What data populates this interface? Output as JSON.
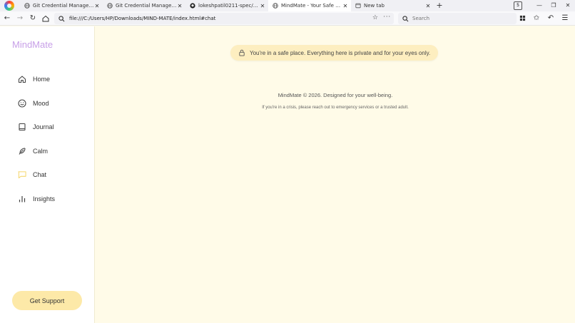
{
  "browser": {
    "tabs": [
      {
        "title": "Git Credential Manager - Auth",
        "icon": "globe-icon",
        "active": false
      },
      {
        "title": "Git Credential Manager - Auth",
        "icon": "globe-icon",
        "active": false
      },
      {
        "title": "lokeshpatil0211-spec/MindMate",
        "icon": "github-icon",
        "active": false
      },
      {
        "title": "MindMate - Your Safe Space",
        "icon": "globe-icon",
        "active": true
      },
      {
        "title": "New tab",
        "icon": "newtab-icon",
        "active": false
      }
    ],
    "new_tab_label": "+",
    "url": "file:///C:/Users/HP/Downloads/MIND-MATE/index.html#chat",
    "search_placeholder": "Search"
  },
  "sidebar": {
    "brand": "MindMate",
    "items": [
      {
        "label": "Home",
        "icon": "home-icon"
      },
      {
        "label": "Mood",
        "icon": "smile-icon"
      },
      {
        "label": "Journal",
        "icon": "book-icon"
      },
      {
        "label": "Calm",
        "icon": "feather-icon"
      },
      {
        "label": "Chat",
        "icon": "chat-bubble-icon",
        "active": true
      },
      {
        "label": "Insights",
        "icon": "bar-chart-icon"
      }
    ],
    "support_label": "Get Support"
  },
  "main": {
    "notice": "You're in a safe place. Everything here is private and for your eyes only.",
    "footer_line1": "MindMate © 2026. Designed for your well-being.",
    "footer_line2": "If you're in a crisis, please reach out to emergency services or a trusted adult."
  },
  "colors": {
    "brand": "#c8a0e8",
    "background": "#fffbe8",
    "notice_bg": "#fdeec0",
    "support_bg": "#fde9a8",
    "chat_icon": "#f5d76e"
  }
}
